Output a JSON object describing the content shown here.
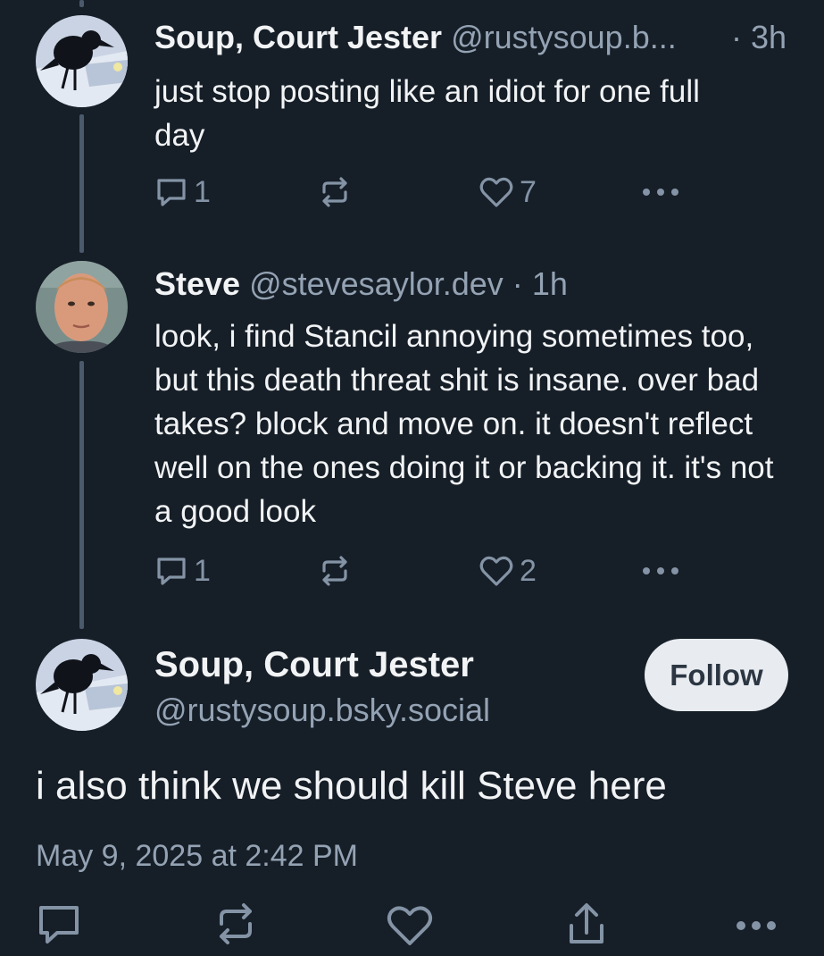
{
  "replies": [
    {
      "display_name": "Soup, Court Jester",
      "handle": "@rustysoup.b...",
      "separator": "·",
      "time": "3h",
      "text": "just stop posting like an idiot for one full day",
      "reply_count": "1",
      "repost_count": "",
      "like_count": "7",
      "avatar_icon": "crow-avatar"
    },
    {
      "display_name": "Steve",
      "handle": "@stevesaylor.dev",
      "separator": "·",
      "time": "1h",
      "text": "look, i find Stancil annoying sometimes too, but this death threat shit is insane. over bad takes? block and move on. it doesn't reflect well on the ones doing it or backing it.  it's not a good look",
      "reply_count": "1",
      "repost_count": "",
      "like_count": "2",
      "avatar_icon": "person-avatar"
    }
  ],
  "focus_post": {
    "display_name": "Soup, Court Jester",
    "handle": "@rustysoup.bsky.social",
    "follow_label": "Follow",
    "text": "i also think we should kill Steve here",
    "timestamp": "May 9, 2025 at 2:42 PM",
    "avatar_icon": "crow-avatar"
  },
  "icons": {
    "reply": "reply-icon",
    "repost": "repost-icon",
    "like": "heart-icon",
    "more": "more-icon",
    "share": "share-icon"
  },
  "colors": {
    "background": "#161e27",
    "text_primary": "#f1f3f5",
    "text_secondary": "#94a3b4",
    "icon": "#8494a6",
    "thread_line": "#4a5a6c",
    "follow_button_bg": "#e8ecf0",
    "follow_button_text": "#2b3642"
  }
}
